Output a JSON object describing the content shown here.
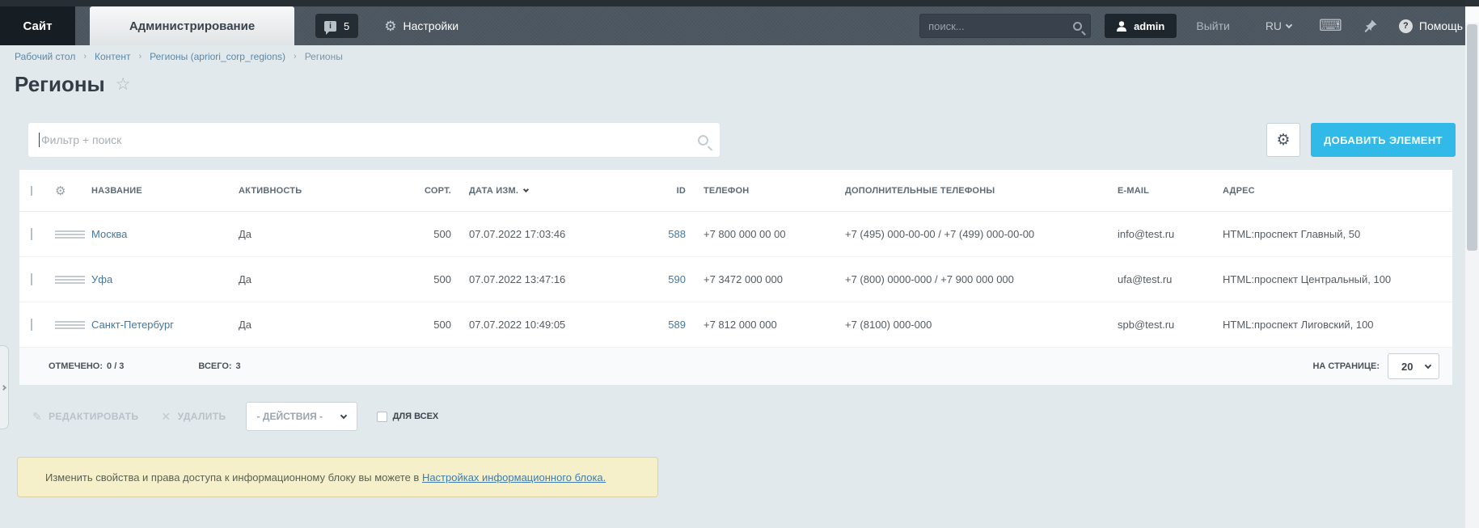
{
  "topbar": {
    "site_tab": "Сайт",
    "admin_tab": "Администрирование",
    "notify_count": "5",
    "settings_label": "Настройки",
    "search_placeholder": "поиск...",
    "user": "admin",
    "logout_label": "Выйти",
    "lang": "RU",
    "help_label": "Помощь"
  },
  "breadcrumb": {
    "items": [
      "Рабочий стол",
      "Контент",
      "Регионы (apriori_corp_regions)",
      "Регионы"
    ]
  },
  "page": {
    "title": "Регионы"
  },
  "filter": {
    "placeholder": "Фильтр + поиск"
  },
  "toolbar": {
    "add_label": "ДОБАВИТЬ ЭЛЕМЕНТ"
  },
  "table": {
    "columns": [
      "НАЗВАНИЕ",
      "АКТИВНОСТЬ",
      "СОРТ.",
      "ДАТА ИЗМ.",
      "ID",
      "ТЕЛЕФОН",
      "ДОПОЛНИТЕЛЬНЫЕ ТЕЛЕФОНЫ",
      "E-MAIL",
      "АДРЕС"
    ],
    "rows": [
      {
        "name": "Москва",
        "active": "Да",
        "sort": "500",
        "modified": "07.07.2022 17:03:46",
        "id": "588",
        "phone": "+7 800 000 00 00",
        "extra_phones": "+7 (495) 000-00-00 / +7 (499) 000-00-00",
        "email": "info@test.ru",
        "address": "HTML:проспект Главный, 50"
      },
      {
        "name": "Уфа",
        "active": "Да",
        "sort": "500",
        "modified": "07.07.2022 13:47:16",
        "id": "590",
        "phone": "+7 3472 000 000",
        "extra_phones": "+7 (800) 0000-000 / +7 900 000 000",
        "email": "ufa@test.ru",
        "address": "HTML:проспект Центральный, 100"
      },
      {
        "name": "Санкт-Петербург",
        "active": "Да",
        "sort": "500",
        "modified": "07.07.2022 10:49:05",
        "id": "589",
        "phone": "+7 812 000 000",
        "extra_phones": "+7 (8100) 000-000",
        "email": "spb@test.ru",
        "address": "HTML:проспект Лиговский, 100"
      }
    ],
    "footer": {
      "checked_label": "ОТМЕЧЕНО:",
      "checked_value": "0 / 3",
      "total_label": "ВСЕГО:",
      "total_value": "3",
      "per_page_label": "НА СТРАНИЦЕ:",
      "per_page_value": "20"
    }
  },
  "action_bar": {
    "edit_label": "РЕДАКТИРОВАТЬ",
    "delete_label": "УДАЛИТЬ",
    "actions_dropdown": "- ДЕЙСТВИЯ -",
    "for_all_label": "ДЛЯ ВСЕХ"
  },
  "notice": {
    "text_before": "Изменить свойства и права доступа к информационному блоку вы можете в ",
    "link_text": "Настройках информационного блока."
  },
  "icons": {
    "gear": "⚙",
    "star": "☆",
    "pencil": "✎",
    "cross": "✕",
    "keyboard": "⌨",
    "question": "?",
    "info": "i"
  },
  "colors": {
    "accent_button": "#31b9e8",
    "link": "#44779f",
    "topbar_bg": "#4d5761",
    "page_bg": "#e2e9ec",
    "notice_bg": "#f6f0ca"
  }
}
